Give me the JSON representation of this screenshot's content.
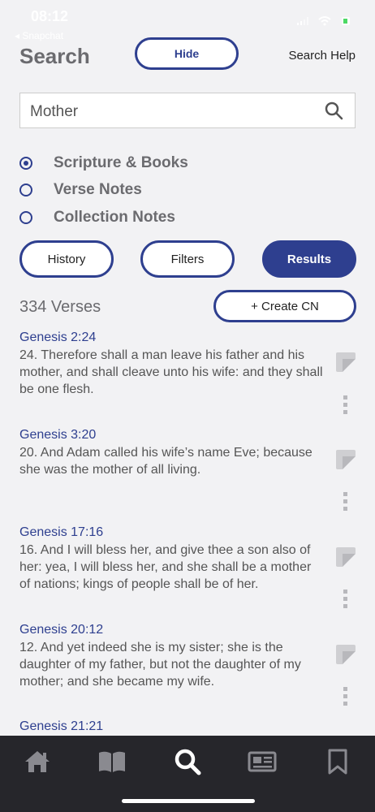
{
  "status": {
    "time": "08:12",
    "back_app": "◂ Snapchat"
  },
  "header": {
    "title": "Search",
    "hide_label": "Hide",
    "help_label": "Search Help"
  },
  "search": {
    "value": "Mother"
  },
  "scope": [
    {
      "label": "Scripture & Books",
      "selected": true
    },
    {
      "label": "Verse Notes",
      "selected": false
    },
    {
      "label": "Collection Notes",
      "selected": false
    }
  ],
  "segments": {
    "history": "History",
    "filters": "Filters",
    "results": "Results"
  },
  "results": {
    "count": "334 Verses",
    "create_label": "+ Create CN"
  },
  "verses": [
    {
      "ref": "Genesis 2:24",
      "text": "24. Therefore shall a man leave his father and his mother, and shall cleave unto his wife: and they shall be one flesh."
    },
    {
      "ref": "Genesis 3:20",
      "text": "20. And Adam called his wife’s name Eve; because she was the mother of all living."
    },
    {
      "ref": "Genesis 17:16",
      "text": "16. And I will bless her, and give thee a son also of her: yea, I will bless her, and she shall be a mother of nations; kings of people shall be of her."
    },
    {
      "ref": "Genesis 20:12",
      "text": "12. And yet indeed she is my sister; she is the daughter of my father, but not the daughter of my mother; and she became my wife."
    },
    {
      "ref": "Genesis 21:21",
      "text": ""
    }
  ],
  "tabbar": {
    "icons": [
      "home-icon",
      "book-icon",
      "search-icon",
      "news-icon",
      "bookmark-icon"
    ],
    "active": "search-icon"
  },
  "colors": {
    "accent": "#2e3f8f",
    "tabbar": "#26262b",
    "background": "#f2f2f4"
  }
}
